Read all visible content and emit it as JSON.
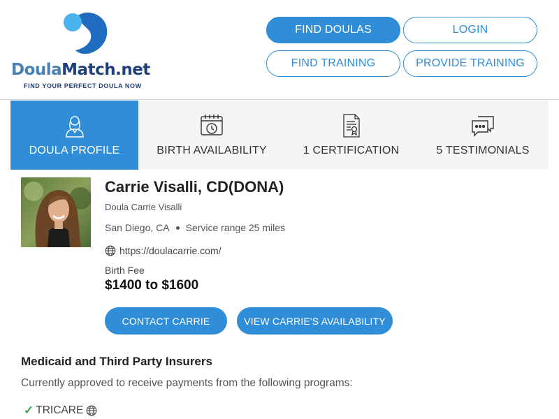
{
  "logo": {
    "name_part1": "Doula",
    "name_part2": "Match.net",
    "tagline": "FIND YOUR PERFECT DOULA NOW",
    "color_light": "#4ab3f0",
    "color_dark": "#1f6cc0"
  },
  "nav": {
    "find_doulas": "FIND DOULAS",
    "login": "LOGIN",
    "find_training": "FIND TRAINING",
    "provide_training": "PROVIDE TRAINING"
  },
  "tabs": [
    {
      "label": "DOULA PROFILE",
      "icon": "doula-profile-icon",
      "active": true
    },
    {
      "label": "BIRTH AVAILABILITY",
      "icon": "calendar-clock-icon",
      "active": false
    },
    {
      "label": "1 CERTIFICATION",
      "icon": "certificate-icon",
      "active": false
    },
    {
      "label": "5 TESTIMONIALS",
      "icon": "chat-bubbles-icon",
      "active": false
    }
  ],
  "profile": {
    "name": "Carrie Visalli, CD(DONA)",
    "business_name": "Doula Carrie Visalli",
    "location": "San Diego, CA",
    "service_range": "Service range 25 miles",
    "website": "https://doulacarrie.com/",
    "fee_label": "Birth Fee",
    "fee": "$1400 to $1600",
    "contact_button": "CONTACT CARRIE",
    "availability_button": "VIEW CARRIE'S AVAILABILITY"
  },
  "insurance": {
    "title": "Medicaid and Third Party Insurers",
    "description": "Currently approved to receive payments from the following programs:",
    "programs": [
      "TRICARE"
    ]
  },
  "colors": {
    "accent": "#2f8ed7",
    "check": "#3aa84b"
  }
}
